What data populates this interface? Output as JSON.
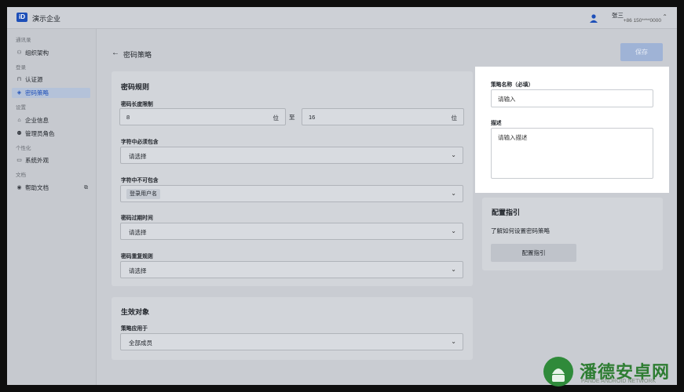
{
  "header": {
    "logo_text": "iD",
    "org_name": "演示企业",
    "user_name": "张三",
    "user_phone": "+86 150****0000"
  },
  "sidebar": {
    "groups": {
      "contacts": "通讯录",
      "login": "登录",
      "settings": "设置",
      "personalization": "个性化",
      "docs": "文档"
    },
    "items": [
      {
        "label": "组织架构",
        "icon": "org-icon"
      },
      {
        "label": "认证源",
        "icon": "lock-icon"
      },
      {
        "label": "密码策略",
        "icon": "shield-icon"
      },
      {
        "label": "企业信息",
        "icon": "building-icon"
      },
      {
        "label": "管理员角色",
        "icon": "admin-icon"
      },
      {
        "label": "系统外观",
        "icon": "monitor-icon"
      },
      {
        "label": "帮助文档",
        "icon": "location-icon"
      }
    ]
  },
  "page": {
    "title": "密码策略",
    "save_label": "保存"
  },
  "rules": {
    "title": "密码规则",
    "length_label": "密码长度限制",
    "min_value": "8",
    "max_value": "16",
    "unit": "位",
    "to_text": "至",
    "must_include_label": "字符中必须包含",
    "must_include_placeholder": "请选择",
    "must_exclude_label": "字符中不可包含",
    "must_exclude_tag": "登录用户名",
    "expiry_label": "密码过期时间",
    "expiry_placeholder": "请选择",
    "repeat_label": "密码重复规则",
    "repeat_placeholder": "请选择"
  },
  "effect": {
    "title": "生效对象",
    "apply_label": "策略应用于",
    "apply_value": "全部成员"
  },
  "policy_panel": {
    "name_label": "策略名称（必填）",
    "name_placeholder": "请输入",
    "desc_label": "描述",
    "desc_placeholder": "请输入描述"
  },
  "guide": {
    "title": "配置指引",
    "text": "了解如何设置密码策略",
    "button": "配置指引"
  },
  "watermark": {
    "text": "潘德安卓网",
    "sub": "PANDE ANDROID NETWORK"
  }
}
